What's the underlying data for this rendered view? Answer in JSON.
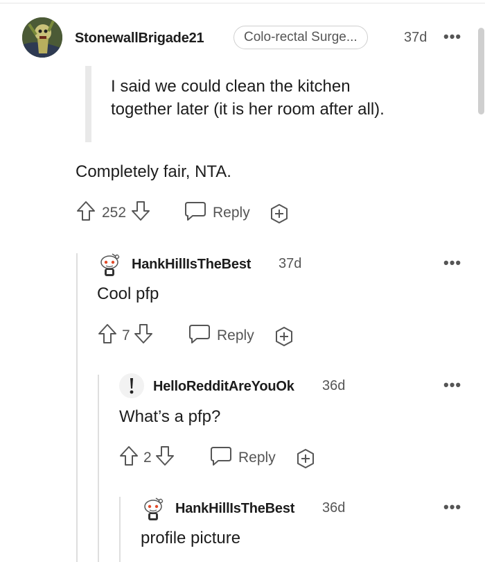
{
  "comments": [
    {
      "username": "StonewallBrigade21",
      "flair": "Colo-rectal Surge...",
      "age": "37d",
      "quote_lines": [
        "I said we could clean the kitchen",
        "together later (it is her room after all)."
      ],
      "body": "Completely fair, NTA.",
      "score": "252",
      "reply_label": "Reply",
      "avatar": "iron-maiden-eddie-avatar"
    },
    {
      "username": "HankHillIsTheBest",
      "age": "37d",
      "body": "Cool pfp",
      "score": "7",
      "reply_label": "Reply",
      "avatar": "snoo-avatar"
    },
    {
      "username": "HelloRedditAreYouOk",
      "age": "36d",
      "body": "What’s a pfp?",
      "score": "2",
      "reply_label": "Reply",
      "avatar": "exclamation-avatar"
    },
    {
      "username": "HankHillIsTheBest",
      "age": "36d",
      "body": "profile picture",
      "avatar": "snoo-avatar"
    }
  ],
  "more_label": "•••",
  "colors": {
    "text": "#1c1c1c",
    "muted": "#555555",
    "thread": "#dedede"
  }
}
